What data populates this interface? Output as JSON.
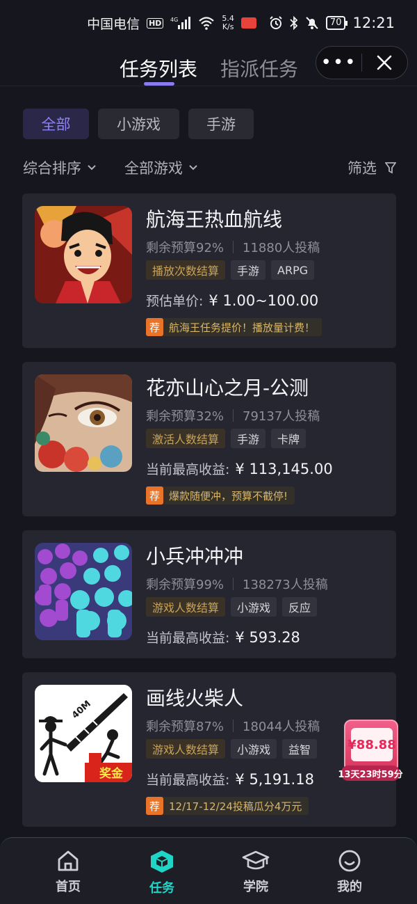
{
  "status_bar": {
    "carrier": "中国电信",
    "hd": "HD",
    "network": "4G",
    "speed_value": "5.4",
    "speed_unit": "K/s",
    "battery": "70",
    "time": "12:21"
  },
  "header": {
    "tabs": [
      {
        "label": "任务列表",
        "active": true
      },
      {
        "label": "指派任务",
        "active": false
      }
    ],
    "more_label": "•••"
  },
  "filters": {
    "chips": [
      {
        "label": "全部",
        "active": true
      },
      {
        "label": "小游戏",
        "active": false
      },
      {
        "label": "手游",
        "active": false
      }
    ],
    "sort_label": "综合排序",
    "game_filter_label": "全部游戏",
    "filter_label": "筛选"
  },
  "tasks": [
    {
      "title": "航海王热血航线",
      "budget": "剩余预算92%",
      "submissions": "11880人投稿",
      "tags": [
        {
          "label": "播放次数结算",
          "highlight": true
        },
        {
          "label": "手游",
          "highlight": false
        },
        {
          "label": "ARPG",
          "highlight": false
        }
      ],
      "price_label": "预估单价:",
      "price_value": "¥ 1.00~100.00",
      "rec_badge": "荐",
      "rec_text": "航海王任务提价！播放量计费！"
    },
    {
      "title": "花亦山心之月-公测",
      "budget": "剩余预算32%",
      "submissions": "79137人投稿",
      "tags": [
        {
          "label": "激活人数结算",
          "highlight": true
        },
        {
          "label": "手游",
          "highlight": false
        },
        {
          "label": "卡牌",
          "highlight": false
        }
      ],
      "price_label": "当前最高收益:",
      "price_value": "¥ 113,145.00",
      "rec_badge": "荐",
      "rec_text": "爆款随便冲，预算不截停!"
    },
    {
      "title": "小兵冲冲冲",
      "budget": "剩余预算99%",
      "submissions": "138273人投稿",
      "tags": [
        {
          "label": "游戏人数结算",
          "highlight": true
        },
        {
          "label": "小游戏",
          "highlight": false
        },
        {
          "label": "反应",
          "highlight": false
        }
      ],
      "price_label": "当前最高收益:",
      "price_value": "¥ 593.28"
    },
    {
      "title": "画线火柴人",
      "budget": "剩余预算87%",
      "submissions": "18044人投稿",
      "thumb_text_1": "40M",
      "thumb_badge": "奖金",
      "tags": [
        {
          "label": "游戏人数结算",
          "highlight": true
        },
        {
          "label": "小游戏",
          "highlight": false
        },
        {
          "label": "益智",
          "highlight": false
        }
      ],
      "price_label": "当前最高收益:",
      "price_value": "¥ 5,191.18",
      "rec_badge": "荐",
      "rec_text": "12/17-12/24投稿瓜分4万元"
    }
  ],
  "promo": {
    "amount": "¥88.88",
    "countdown": "13天23时59分"
  },
  "bottom_nav": [
    {
      "label": "首页",
      "icon": "home-icon",
      "active": false
    },
    {
      "label": "任务",
      "icon": "task-cube-icon",
      "active": true
    },
    {
      "label": "学院",
      "icon": "graduation-cap-icon",
      "active": false
    },
    {
      "label": "我的",
      "icon": "smile-profile-icon",
      "active": false
    }
  ],
  "colors": {
    "background": "#16161e",
    "card": "#262630",
    "accent_purple": "#8e83f5",
    "accent_teal": "#1fd6c6",
    "tag_gold": "#c9a35a",
    "rec_orange": "#e8742a"
  }
}
